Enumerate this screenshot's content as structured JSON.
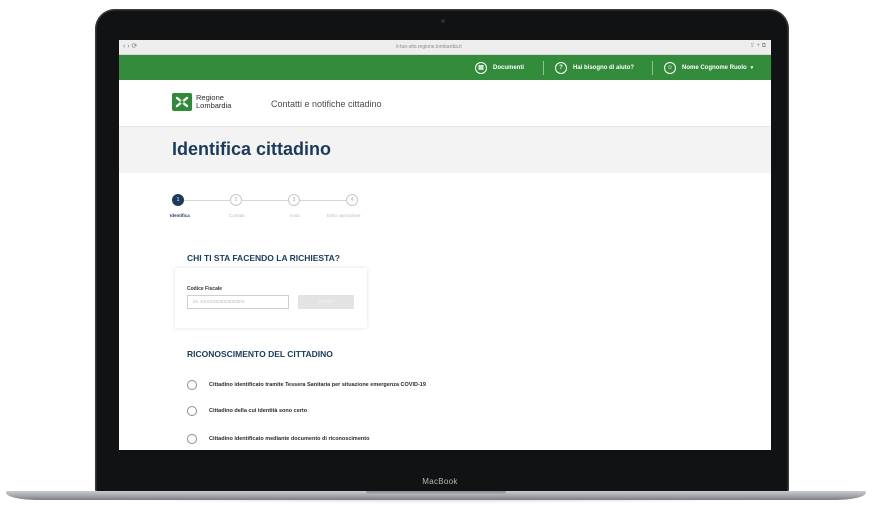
{
  "device": {
    "brand": "MacBook"
  },
  "browser": {
    "nav": "‹ › ⟳",
    "url": "il-tuo-sito.regione.lombardia.it",
    "tools": "⇪ + ⧉"
  },
  "topbar": {
    "documents_label": "Documenti",
    "help_label": "Hai bisogno di aiuto?",
    "user_label": "Nome Cognome Ruolo"
  },
  "header": {
    "logo_line1": "Regione",
    "logo_line2": "Lombardia",
    "title": "Contatti e notifiche cittadino"
  },
  "page": {
    "title": "Identifica cittadino"
  },
  "stepper": {
    "steps": [
      {
        "number": "1",
        "label": "Identifica"
      },
      {
        "number": "2",
        "label": "Contatti"
      },
      {
        "number": "3",
        "label": "Invia"
      },
      {
        "number": "4",
        "label": "Esito operazione"
      }
    ],
    "current": 1
  },
  "richiesta": {
    "title": "CHI TI STA FACENDO LA RICHIESTA?",
    "field_label": "Codice Fiscale",
    "field_placeholder": "es. XXXXXX00X00X000X",
    "button_label": "CERCA"
  },
  "riconoscimento": {
    "title": "RICONOSCIMENTO DEL CITTADINO",
    "options": [
      "Cittadino identificato tramite Tessera Sanitaria per situazione emergenza COVID-19",
      "Cittadino della cui identità sono certo",
      "Cittadino identificato mediante documento di riconoscimento"
    ]
  }
}
